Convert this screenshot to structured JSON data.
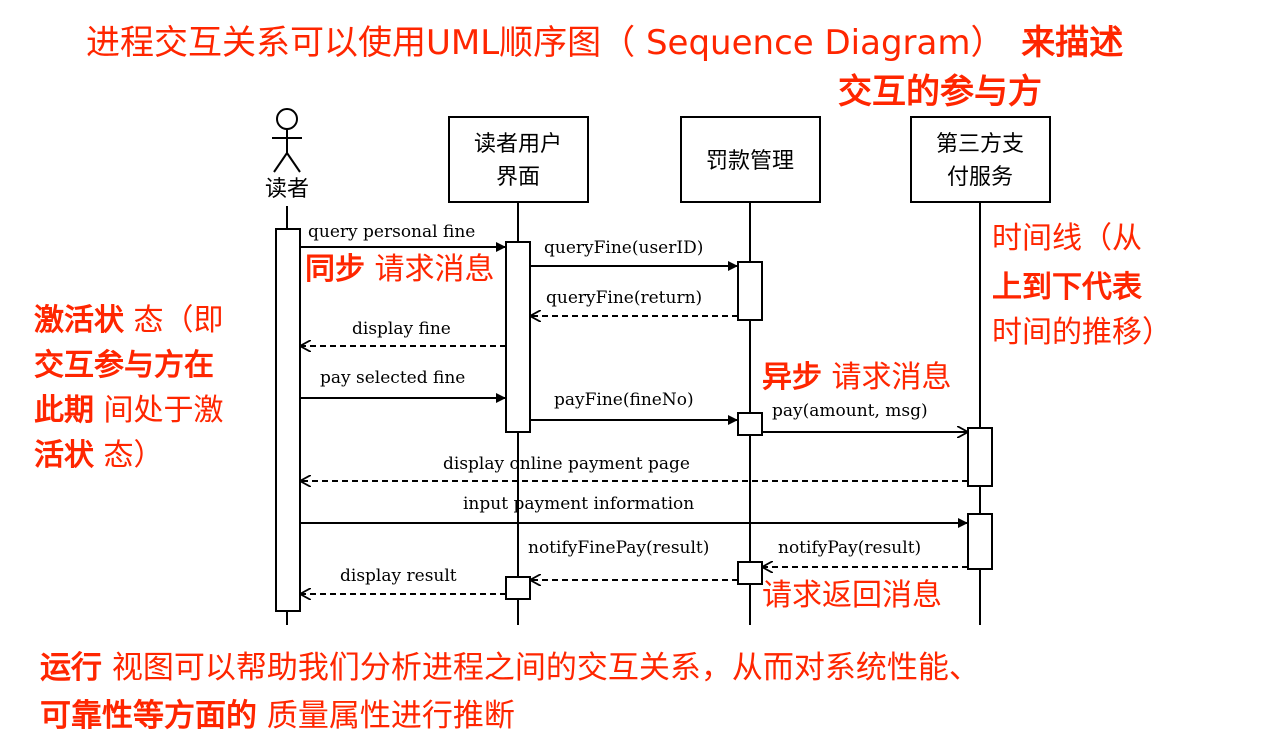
{
  "heading": {
    "line1_normal": "进程交互关系可以使用UML顺序图（ Sequence Diagram）",
    "line1_bold": "来描述",
    "line2_bold": "交互的参与方"
  },
  "participants": {
    "actor": "读者",
    "ui_line1": "读者用户",
    "ui_line2": "界面",
    "fine": "罚款管理",
    "pay_line1": "第三方支",
    "pay_line2": "付服务"
  },
  "messages": {
    "m1": "query personal fine",
    "m2": "queryFine(userID)",
    "m3": "queryFine(return)",
    "m4": "display fine",
    "m5": "pay selected fine",
    "m6": "payFine(fineNo)",
    "m7": "pay(amount, msg)",
    "m8": "display online payment page",
    "m9": "input payment information",
    "m10": "notifyFinePay(result)",
    "m11": "notifyPay(result)",
    "m12": "display result"
  },
  "annotations": {
    "sync_bold": "同步",
    "sync_normal": "请求消息",
    "async_bold": "异步",
    "async_normal": "请求消息",
    "return_msg": "请求返回消息",
    "timeline_l1": "时间线（从",
    "timeline_l2_bold": "上到下代表",
    "timeline_l3": "时间的推移）",
    "activation_l1_bold": "激活状",
    "activation_l1_normal": "态（即",
    "activation_l2_bold": "交互参与方在",
    "activation_l3_bold": "此期",
    "activation_l3_normal": "间处于激",
    "activation_l4_bold": "活状",
    "activation_l4_normal": "态）"
  },
  "footer": {
    "l1_bold": "运行",
    "l1_normal": "视图可以帮助我们分析进程之间的交互关系，从而对系统性能、",
    "l2_bold": "可靠性等方面的",
    "l2_normal": "质量属性进行推断"
  },
  "colors": {
    "accent": "#ff2600",
    "ink": "#000000"
  }
}
